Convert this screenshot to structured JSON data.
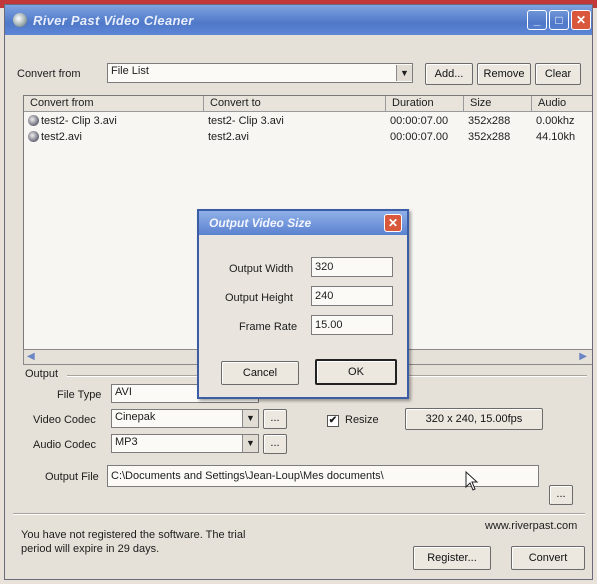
{
  "window": {
    "title": "River Past Video Cleaner"
  },
  "toolbar": {
    "convert_from_label": "Convert from",
    "source_value": "File List",
    "add_label": "Add...",
    "remove_label": "Remove",
    "clear_label": "Clear"
  },
  "list": {
    "columns": [
      "Convert from",
      "Convert to",
      "Duration",
      "Size",
      "Audio"
    ],
    "rows": [
      [
        "test2- Clip 3.avi",
        "test2- Clip 3.avi",
        "00:00:07.00",
        "352x288",
        "0.00khz"
      ],
      [
        "test2.avi",
        "test2.avi",
        "00:00:07.00",
        "352x288",
        "44.10kh"
      ]
    ]
  },
  "dialog": {
    "title": "Output Video Size",
    "width_label": "Output Width",
    "width_value": "320",
    "height_label": "Output Height",
    "height_value": "240",
    "rate_label": "Frame Rate",
    "rate_value": "15.00",
    "cancel_label": "Cancel",
    "ok_label": "OK"
  },
  "output": {
    "group_label": "Output",
    "file_type_label": "File Type",
    "file_type_value": "AVI",
    "video_codec_label": "Video Codec",
    "video_codec_value": "Cinepak",
    "audio_codec_label": "Audio Codec",
    "audio_codec_value": "MP3",
    "browse_label": "...",
    "resize_label": "Resize",
    "resize_checked": true,
    "resize_value": "320 x 240, 15.00fps",
    "output_file_label": "Output File",
    "output_file_value": "C:\\Documents and Settings\\Jean-Loup\\Mes documents\\"
  },
  "footer": {
    "trial_notice_line1": "You have not registered the software. The trial",
    "trial_notice_line2": "period will expire in 29 days.",
    "website": "www.riverpast.com",
    "register_label": "Register...",
    "convert_label": "Convert"
  },
  "colors": {
    "title_bar": "#4f78c8",
    "dialog_close": "#d9583c",
    "top_strip": "#c2383a"
  }
}
